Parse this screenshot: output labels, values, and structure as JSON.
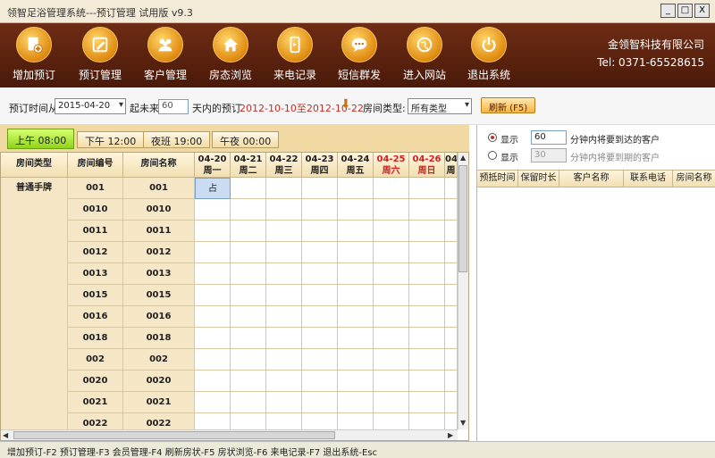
{
  "window": {
    "title": "领智足浴管理系统---预订管理 试用版 v9.3",
    "buttons": [
      "_",
      "□",
      "X"
    ]
  },
  "toolbar": {
    "items": [
      {
        "label": "增加预订",
        "icon": "add-booking-icon"
      },
      {
        "label": "预订管理",
        "icon": "edit-icon"
      },
      {
        "label": "客户管理",
        "icon": "users-icon"
      },
      {
        "label": "房态浏览",
        "icon": "home-icon"
      },
      {
        "label": "来电记录",
        "icon": "phone-icon"
      },
      {
        "label": "短信群发",
        "icon": "chat-icon"
      },
      {
        "label": "进入网站",
        "icon": "globe-icon"
      },
      {
        "label": "退出系统",
        "icon": "power-icon"
      }
    ],
    "company": "金领智科技有限公司",
    "tel": "Tel: 0371-65528615"
  },
  "filter": {
    "label_from": "预订时间从",
    "date_value": "2015-04-20",
    "label_future": "起未来",
    "days_value": "60",
    "label_days": "天内的预订",
    "range_text": "2012-10-10至2012-10-22",
    "label_room_type": "房间类型:",
    "room_type_value": "所有类型",
    "refresh_label": "刷新 (F5)"
  },
  "shifts": [
    {
      "label": "上午 08:00",
      "active": true
    },
    {
      "label": "下午 12:00",
      "active": false
    },
    {
      "label": "夜班 19:00",
      "active": false
    },
    {
      "label": "午夜 00:00",
      "active": false
    }
  ],
  "grid": {
    "headers": {
      "type": "房间类型",
      "number": "房间编号",
      "name": "房间名称"
    },
    "dates": [
      {
        "date": "04-20",
        "day": "周一",
        "weekend": false
      },
      {
        "date": "04-21",
        "day": "周二",
        "weekend": false
      },
      {
        "date": "04-22",
        "day": "周三",
        "weekend": false
      },
      {
        "date": "04-23",
        "day": "周四",
        "weekend": false
      },
      {
        "date": "04-24",
        "day": "周五",
        "weekend": false
      },
      {
        "date": "04-25",
        "day": "周六",
        "weekend": true
      },
      {
        "date": "04-26",
        "day": "周日",
        "weekend": true
      },
      {
        "date": "04-",
        "day": "周",
        "weekend": false
      }
    ],
    "room_type": "普通手牌",
    "rows": [
      {
        "number": "001",
        "name": "001",
        "occupied_col": 0,
        "occupied_text": "占"
      },
      {
        "number": "0010",
        "name": "0010"
      },
      {
        "number": "0011",
        "name": "0011"
      },
      {
        "number": "0012",
        "name": "0012"
      },
      {
        "number": "0013",
        "name": "0013"
      },
      {
        "number": "0015",
        "name": "0015"
      },
      {
        "number": "0016",
        "name": "0016"
      },
      {
        "number": "0018",
        "name": "0018"
      },
      {
        "number": "002",
        "name": "002"
      },
      {
        "number": "0020",
        "name": "0020"
      },
      {
        "number": "0021",
        "name": "0021"
      },
      {
        "number": "0022",
        "name": "0022"
      }
    ]
  },
  "right_panel": {
    "opt1": {
      "label": "显示",
      "value": "60",
      "suffix": "分钟内将要到达的客户",
      "checked": true
    },
    "opt2": {
      "label": "显示",
      "value": "30",
      "suffix": "分钟内将要到期的客户",
      "checked": false
    },
    "columns": [
      "预抵时间",
      "保留时长",
      "客户名称",
      "联系电话",
      "房间名称"
    ]
  },
  "statusbar": {
    "text": "增加预订-F2 预订管理-F3 会员管理-F4 刷新房状-F5 房状浏览-F6 来电记录-F7 退出系统-Esc"
  }
}
